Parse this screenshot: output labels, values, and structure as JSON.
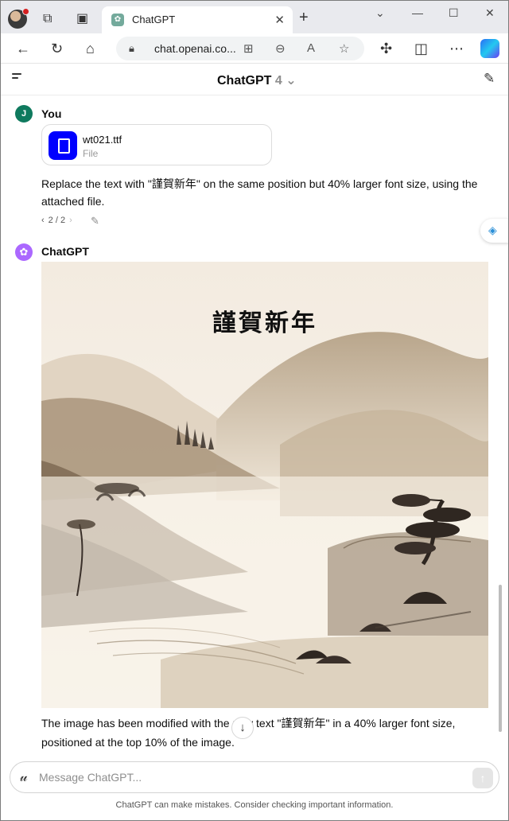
{
  "browser": {
    "tab_title": "ChatGPT",
    "tab_close": "✕",
    "new_tab": "+",
    "url": "chat.openai.co...",
    "window_controls": {
      "minimize": "—",
      "maximize": "☐",
      "close": "✕"
    },
    "icons": [
      "back-icon",
      "refresh-icon",
      "home-icon",
      "lock-icon",
      "grid-icon",
      "zoom-icon",
      "read-aloud-icon",
      "favorite-icon",
      "extensions-icon",
      "split-screen-icon",
      "more-icon",
      "copilot-icon"
    ]
  },
  "app": {
    "title": "ChatGPT",
    "model_version": "4",
    "model_chevron": "⌄"
  },
  "messages": [
    {
      "author": "You",
      "avatar_letter": "J",
      "attachment": {
        "name": "wt021.ttf",
        "type": "File"
      },
      "text": "Replace the text with \"謹賀新年\" on the same position but 40% larger font size, using the attached file.",
      "pager": {
        "prev": "‹",
        "label": "2 / 2",
        "next": "›"
      }
    },
    {
      "author": "ChatGPT",
      "image": {
        "overlay_text": "謹賀新年",
        "palette": [
          "#f5eee3",
          "#e7dccb",
          "#c9b9a2",
          "#8f7d66",
          "#3a302a"
        ]
      },
      "text": "The image has been modified with the new text \"謹賀新年\" in a 40% larger font size, positioned at the top 10% of the image."
    }
  ],
  "composer": {
    "placeholder": "Message ChatGPT...",
    "send": "↑",
    "attach": "⊘"
  },
  "scroll_down": "↓",
  "disclaimer": "ChatGPT can make mistakes. Consider checking important information."
}
